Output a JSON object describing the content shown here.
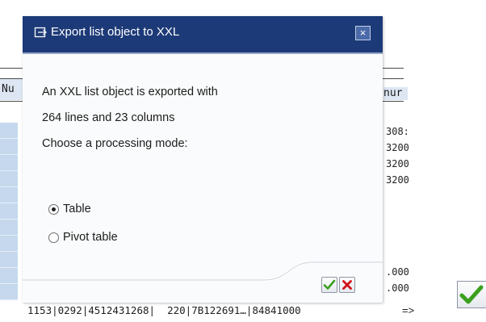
{
  "background": {
    "left_header": "Nu",
    "right_header": "nur",
    "right_numbers": [
      "308:",
      "3200",
      "3200",
      "3200",
      "",
      "",
      "",
      ".000",
      ".000"
    ],
    "bottom_row": "1153|0292|4512431268|  220|7B122691…|84841000"
  },
  "dialog": {
    "title": "Export list object to XXL",
    "close_label": "×",
    "message_lines": [
      "An XXL list object is exported with",
      "264 lines and 23 columns",
      "Choose a processing mode:"
    ],
    "options": [
      {
        "label": "Table",
        "selected": true
      },
      {
        "label": "Pivot table",
        "selected": false
      }
    ]
  },
  "annotation": {
    "arrow": "=>"
  },
  "colors": {
    "titlebar": "#1d3a78",
    "confirm_green": "#3aa01e",
    "cancel_red": "#d0131a"
  },
  "icons": {
    "title": "export-icon",
    "confirm": "check-icon",
    "cancel": "cancel-x-icon"
  }
}
